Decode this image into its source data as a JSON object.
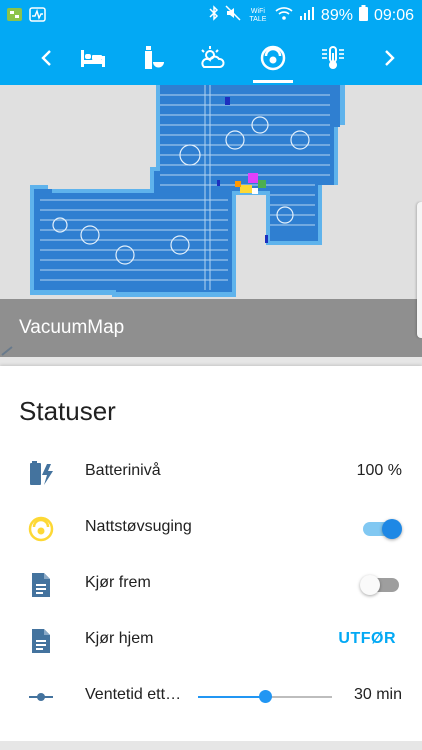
{
  "status_bar": {
    "wifi_label": "WiFi TALE",
    "battery_percent": "89%",
    "time": "09:06"
  },
  "tabs": [
    {
      "name": "chevron-left-icon"
    },
    {
      "name": "bed-icon"
    },
    {
      "name": "bottle-bowl-icon"
    },
    {
      "name": "weather-icon"
    },
    {
      "name": "robot-vacuum-icon",
      "active": true
    },
    {
      "name": "thermometer-icon"
    },
    {
      "name": "chevron-right-icon"
    }
  ],
  "map": {
    "caption": "VacuumMap"
  },
  "status": {
    "title": "Statuser",
    "rows": [
      {
        "label": "Batterinivå",
        "value": "100 %",
        "icon": "battery-charging-icon"
      },
      {
        "label": "Nattstøvsuging",
        "toggle": "on",
        "icon": "robot-vacuum-icon"
      },
      {
        "label": "Kjør frem",
        "toggle": "off",
        "icon": "file-document-icon"
      },
      {
        "label": "Kjør hjem",
        "action": "UTFØR",
        "icon": "file-document-icon"
      },
      {
        "label": "Ventetid ett…",
        "value": "30 min",
        "slider_fraction": 0.5,
        "icon": "ray-vertex-icon"
      }
    ]
  },
  "colors": {
    "accent": "#03a9f4",
    "icon_blue": "#44739e",
    "toggle_on": "#1e88e5",
    "vacuum_yellow": "#fdd835"
  }
}
